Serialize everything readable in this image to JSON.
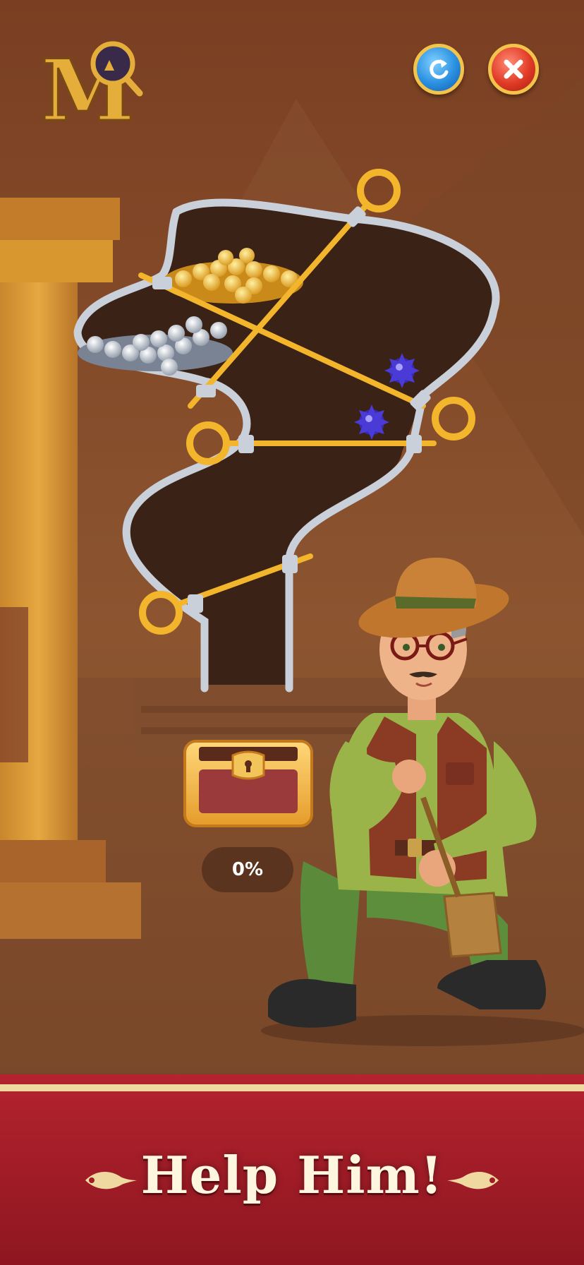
{
  "game": {
    "logo_letter": "M",
    "progress_text": "0%",
    "progress_value": 0,
    "banner_text": "Help Him!"
  },
  "icons": {
    "restart": "restart-arrow-icon",
    "close": "close-x-icon"
  },
  "colors": {
    "banner_red": "#a11c27",
    "gold": "#f2b52c",
    "restart_blue": "#2a8fe0",
    "close_red": "#e03a26"
  }
}
